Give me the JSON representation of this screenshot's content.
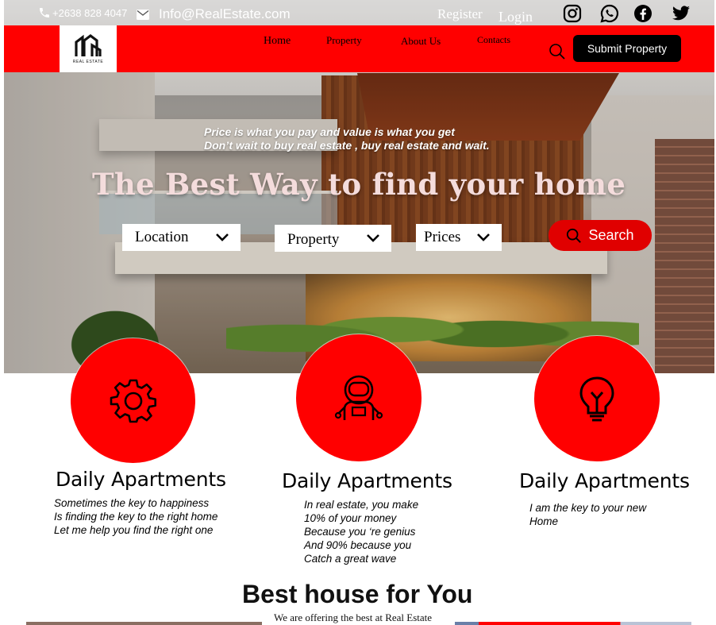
{
  "topbar": {
    "phone": "+2638 828 4047",
    "email": "Info@RealEstate.com",
    "register": "Register",
    "login": "Login",
    "social_icons": [
      "instagram-icon",
      "whatsapp-icon",
      "facebook-icon",
      "twitter-icon"
    ]
  },
  "nav": {
    "logo_text": "REAL ESTATE",
    "links": [
      "Home",
      "Property",
      "About Us",
      "Contacts"
    ],
    "submit_label": "Submit Property"
  },
  "hero": {
    "quote_line1": "Price is what you pay and value is what you get",
    "quote_line2": "Don’t wait to buy real estate , buy real estate and wait.",
    "headline": "The Best Way to find your home",
    "filters": [
      "Location",
      "Property",
      "Prices"
    ],
    "search_label": "Search"
  },
  "features": [
    {
      "icon": "gear-icon",
      "title": "Daily Apartments",
      "text": "Sometimes the key to happiness\nIs finding the key to the right home\nLet me help you find the right one"
    },
    {
      "icon": "astronaut-icon",
      "title": "Daily Apartments",
      "text": "In real estate, you make\n10% of your money\nBecause you ‘re genius\nAnd 90% because you\nCatch a great wave"
    },
    {
      "icon": "lightbulb-icon",
      "title": "Daily Apartments",
      "text": "I am the key to your new\n         Home"
    }
  ],
  "best": {
    "title": "Best house for You",
    "subtitle": "We are offering the best at Real Estate"
  },
  "colors": {
    "brand_red": "#ff0000",
    "dark": "#000000"
  }
}
